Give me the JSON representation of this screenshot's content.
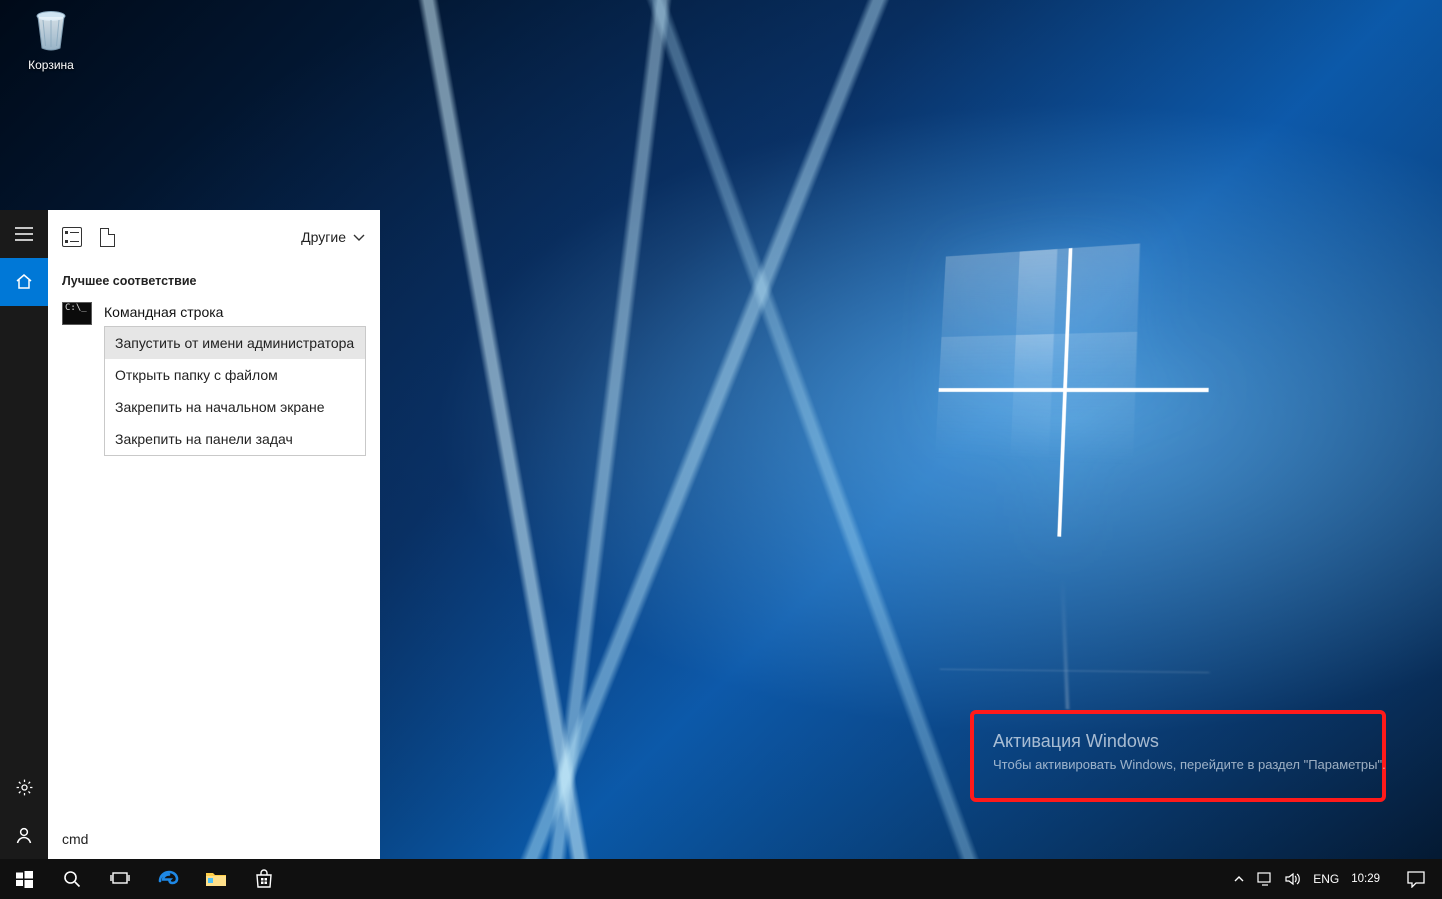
{
  "desktop": {
    "recycle_bin_label": "Корзина"
  },
  "activation": {
    "title": "Активация Windows",
    "body": "Чтобы активировать Windows, перейдите в раздел \"Параметры\"."
  },
  "start": {
    "rail": {
      "hamburger": "menu-icon",
      "home": "home-icon",
      "settings": "gear-icon",
      "user": "user-icon"
    },
    "header": {
      "filter_apps": "apps-filter-icon",
      "filter_docs": "documents-filter-icon",
      "more_label": "Другие"
    },
    "section_label": "Лучшее соответствие",
    "result": {
      "title": "Командная строка",
      "context": [
        "Запустить от имени администратора",
        "Открыть папку с файлом",
        "Закрепить на начальном экране",
        "Закрепить на панели задач"
      ],
      "selected_index": 0
    },
    "search_query": "cmd"
  },
  "taskbar": {
    "items": {
      "start": "windows-start-icon",
      "search": "search-icon",
      "taskview": "taskview-icon",
      "edge": "edge-icon",
      "explorer": "file-explorer-icon",
      "store": "store-icon"
    },
    "tray": {
      "show_hidden": "chevron-up-icon",
      "network": "network-icon",
      "volume": "volume-icon",
      "language": "ENG",
      "time": "10:29",
      "date": "",
      "action_center": "action-center-icon"
    }
  }
}
